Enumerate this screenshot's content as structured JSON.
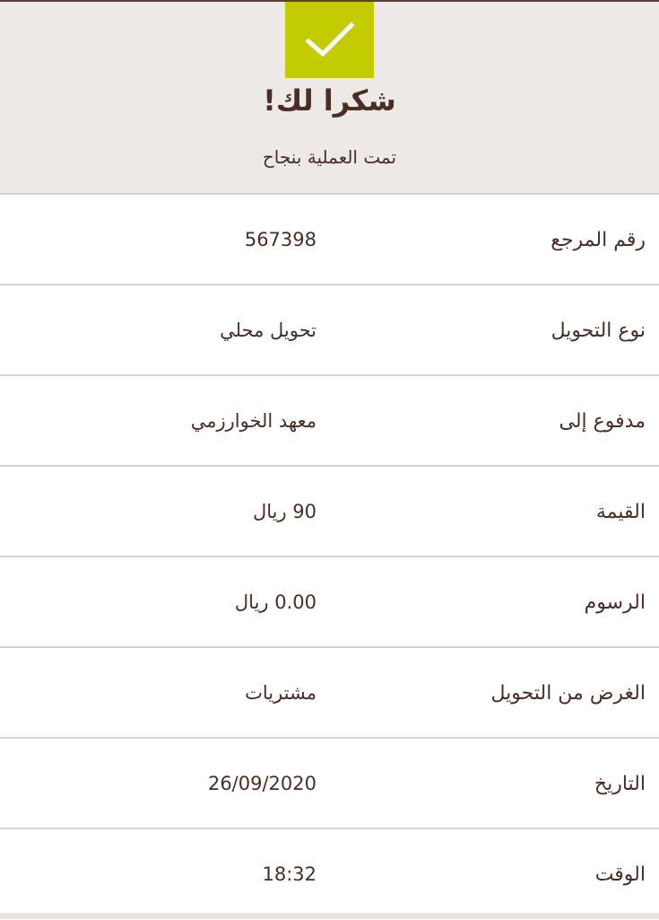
{
  "header": {
    "title": "شكرا لك!",
    "subtitle": "تمت العملية بنجاح",
    "check_icon": "checkmark-icon",
    "accent_color": "#c2cc00"
  },
  "details": [
    {
      "label": "رقم المرجع",
      "value": "567398"
    },
    {
      "label": "نوع التحويل",
      "value": "تحويل محلي"
    },
    {
      "label": "مدفوع إلى",
      "value": "معهد الخوارزمي"
    },
    {
      "label": "القيمة",
      "value": "90 ريال"
    },
    {
      "label": "الرسوم",
      "value": "0.00 ريال"
    },
    {
      "label": "الغرض من التحويل",
      "value": "مشتريات"
    },
    {
      "label": "التاريخ",
      "value": "26/09/2020"
    },
    {
      "label": "الوقت",
      "value": "18:32"
    }
  ]
}
